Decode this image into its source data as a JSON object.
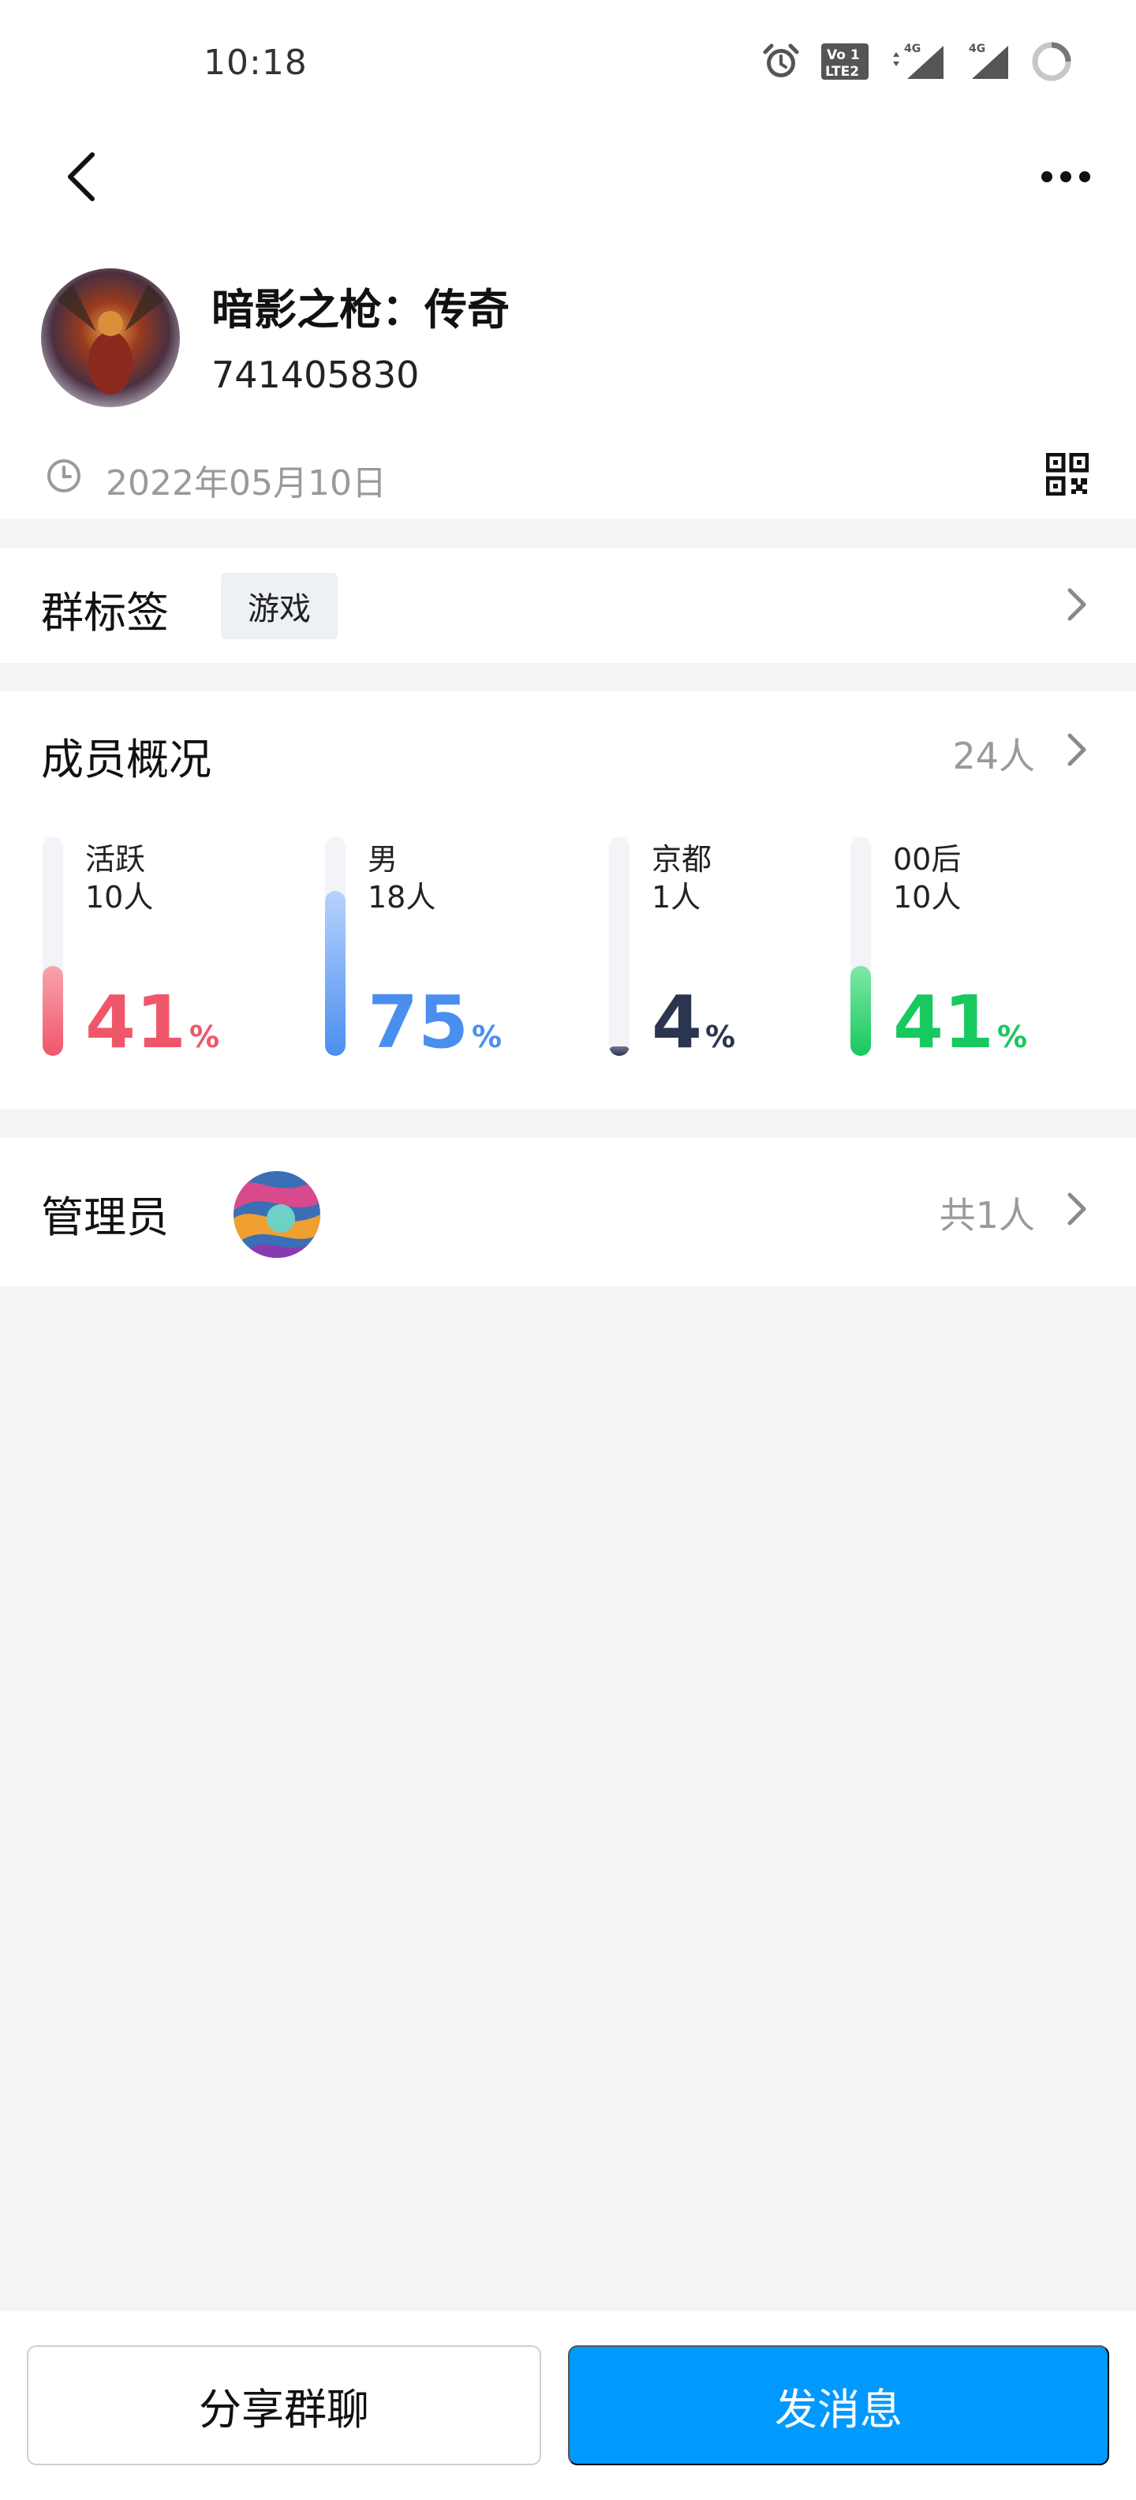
{
  "status_bar": {
    "time": "10:18",
    "icons": [
      "alarm-icon",
      "volte-icon",
      "signal-4g-icon",
      "signal-4g-icon",
      "battery-ring-icon"
    ],
    "volte_label": "Vo LTE",
    "net1": "4G",
    "net2": "4G"
  },
  "nav": {
    "back_icon": "back-chevron-icon",
    "more_icon": "more-dots-icon"
  },
  "group": {
    "name": "暗影之枪：传奇",
    "id": "741405830",
    "created": "2022年05月10日"
  },
  "tags": {
    "title": "群标签",
    "items": [
      "游戏"
    ]
  },
  "members": {
    "title": "成员概况",
    "count": "24人",
    "stats": [
      {
        "label": "活跃",
        "count": "10人",
        "percent": "41",
        "unit": "%",
        "value": 41,
        "color": "#f0566a",
        "color_light": "#f9a3ae"
      },
      {
        "label": "男",
        "count": "18人",
        "percent": "75",
        "unit": "%",
        "value": 75,
        "color": "#4a8ef0",
        "color_light": "#b8d3fb"
      },
      {
        "label": "京都",
        "count": "1人",
        "percent": "4",
        "unit": "%",
        "value": 4,
        "color": "#2c3550",
        "color_light": "#6f7792"
      },
      {
        "label": "00后",
        "count": "10人",
        "percent": "41",
        "unit": "%",
        "value": 41,
        "color": "#17c95e",
        "color_light": "#7fe7a6"
      }
    ]
  },
  "admins": {
    "title": "管理员",
    "count": "共1人"
  },
  "actions": {
    "share_label": "分享群聊",
    "send_label": "发消息"
  },
  "colors": {
    "primary": "#0099ff",
    "muted_text": "#9a9a9a",
    "page_bg": "#f4f4f5"
  }
}
